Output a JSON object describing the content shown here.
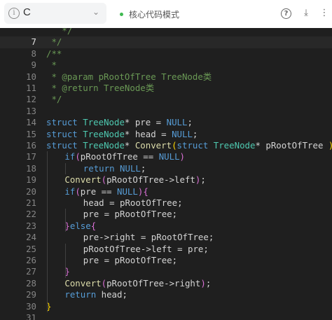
{
  "toolbar": {
    "language": "C",
    "mode_label": "核心代码模式",
    "help_glyph": "?",
    "download_glyph": "⤓",
    "more_glyph": "⋮",
    "chevron_glyph": "⌄",
    "info_glyph": "i"
  },
  "colors": {
    "keyword": "#569cd6",
    "type": "#4ec9b0",
    "function": "#dcdcaa",
    "comment": "#6a9955",
    "bracket": "#ffd700",
    "bracket_nested": "#da70d6",
    "status_dot": "#3fb950"
  },
  "editor": {
    "active_line": 7,
    "lines": [
      {
        "n": "",
        "indent": 0,
        "tokens": [
          {
            "t": " ",
            "c": "cm"
          },
          {
            "t": "  */",
            "c": "cm"
          }
        ]
      },
      {
        "n": "7",
        "indent": 0,
        "tokens": [
          {
            "t": " */",
            "c": "cm"
          }
        ]
      },
      {
        "n": "8",
        "indent": 0,
        "tokens": [
          {
            "t": "/**",
            "c": "cm"
          }
        ]
      },
      {
        "n": "9",
        "indent": 0,
        "tokens": [
          {
            "t": " *",
            "c": "cm"
          }
        ]
      },
      {
        "n": "10",
        "indent": 0,
        "tokens": [
          {
            "t": " * @param pRootOfTree TreeNode类",
            "c": "cm"
          }
        ]
      },
      {
        "n": "11",
        "indent": 0,
        "tokens": [
          {
            "t": " * @return TreeNode类",
            "c": "cm"
          }
        ]
      },
      {
        "n": "12",
        "indent": 0,
        "tokens": [
          {
            "t": " */",
            "c": "cm"
          }
        ]
      },
      {
        "n": "13",
        "indent": 0,
        "tokens": []
      },
      {
        "n": "14",
        "indent": 0,
        "tokens": [
          {
            "t": "struct",
            "c": "kw"
          },
          {
            "t": " ",
            "c": "pl"
          },
          {
            "t": "TreeNode",
            "c": "ty"
          },
          {
            "t": "* pre = ",
            "c": "pl"
          },
          {
            "t": "NULL",
            "c": "kw"
          },
          {
            "t": ";",
            "c": "pl"
          }
        ]
      },
      {
        "n": "15",
        "indent": 0,
        "tokens": [
          {
            "t": "struct",
            "c": "kw"
          },
          {
            "t": " ",
            "c": "pl"
          },
          {
            "t": "TreeNode",
            "c": "ty"
          },
          {
            "t": "* head = ",
            "c": "pl"
          },
          {
            "t": "NULL",
            "c": "kw"
          },
          {
            "t": ";",
            "c": "pl"
          }
        ]
      },
      {
        "n": "16",
        "indent": 0,
        "tokens": [
          {
            "t": "struct",
            "c": "kw"
          },
          {
            "t": " ",
            "c": "pl"
          },
          {
            "t": "TreeNode",
            "c": "ty"
          },
          {
            "t": "* ",
            "c": "pl"
          },
          {
            "t": "Convert",
            "c": "fn"
          },
          {
            "t": "(",
            "c": "br"
          },
          {
            "t": "struct",
            "c": "kw"
          },
          {
            "t": " ",
            "c": "pl"
          },
          {
            "t": "TreeNode",
            "c": "ty"
          },
          {
            "t": "* pRootOfTree ",
            "c": "pl"
          },
          {
            "t": ")",
            "c": "br"
          },
          {
            "t": " ",
            "c": "pl"
          },
          {
            "t": "{",
            "c": "br"
          }
        ]
      },
      {
        "n": "17",
        "indent": 1,
        "tokens": [
          {
            "t": "if",
            "c": "kw"
          },
          {
            "t": "(",
            "c": "br2"
          },
          {
            "t": "pRootOfTree == ",
            "c": "pl"
          },
          {
            "t": "NULL",
            "c": "kw"
          },
          {
            "t": ")",
            "c": "br2"
          }
        ]
      },
      {
        "n": "18",
        "indent": 2,
        "tokens": [
          {
            "t": "return",
            "c": "kw"
          },
          {
            "t": " ",
            "c": "pl"
          },
          {
            "t": "NULL",
            "c": "kw"
          },
          {
            "t": ";",
            "c": "pl"
          }
        ]
      },
      {
        "n": "19",
        "indent": 1,
        "tokens": [
          {
            "t": "Convert",
            "c": "fn"
          },
          {
            "t": "(",
            "c": "br2"
          },
          {
            "t": "pRootOfTree->left",
            "c": "pl"
          },
          {
            "t": ")",
            "c": "br2"
          },
          {
            "t": ";",
            "c": "pl"
          }
        ]
      },
      {
        "n": "20",
        "indent": 1,
        "tokens": [
          {
            "t": "if",
            "c": "kw"
          },
          {
            "t": "(",
            "c": "br2"
          },
          {
            "t": "pre == ",
            "c": "pl"
          },
          {
            "t": "NULL",
            "c": "kw"
          },
          {
            "t": ")",
            "c": "br2"
          },
          {
            "t": "{",
            "c": "br2"
          }
        ]
      },
      {
        "n": "21",
        "indent": 2,
        "tokens": [
          {
            "t": "head = pRootOfTree;",
            "c": "pl"
          }
        ]
      },
      {
        "n": "22",
        "indent": 2,
        "tokens": [
          {
            "t": "pre = pRootOfTree;",
            "c": "pl"
          }
        ]
      },
      {
        "n": "23",
        "indent": 1,
        "tokens": [
          {
            "t": "}",
            "c": "br2"
          },
          {
            "t": "else",
            "c": "kw"
          },
          {
            "t": "{",
            "c": "br2"
          }
        ]
      },
      {
        "n": "24",
        "indent": 2,
        "tokens": [
          {
            "t": "pre->right = pRootOfTree;",
            "c": "pl"
          }
        ]
      },
      {
        "n": "25",
        "indent": 2,
        "tokens": [
          {
            "t": "pRootOfTree->left = pre;",
            "c": "pl"
          }
        ]
      },
      {
        "n": "26",
        "indent": 2,
        "tokens": [
          {
            "t": "pre = pRootOfTree;",
            "c": "pl"
          }
        ]
      },
      {
        "n": "27",
        "indent": 1,
        "tokens": [
          {
            "t": "}",
            "c": "br2"
          }
        ]
      },
      {
        "n": "28",
        "indent": 1,
        "tokens": [
          {
            "t": "Convert",
            "c": "fn"
          },
          {
            "t": "(",
            "c": "br2"
          },
          {
            "t": "pRootOfTree->right",
            "c": "pl"
          },
          {
            "t": ")",
            "c": "br2"
          },
          {
            "t": ";",
            "c": "pl"
          }
        ]
      },
      {
        "n": "29",
        "indent": 1,
        "tokens": [
          {
            "t": "return",
            "c": "kw"
          },
          {
            "t": " head;",
            "c": "pl"
          }
        ]
      },
      {
        "n": "30",
        "indent": 0,
        "tokens": [
          {
            "t": "}",
            "c": "br"
          }
        ]
      },
      {
        "n": "31",
        "indent": 0,
        "tokens": []
      }
    ]
  }
}
